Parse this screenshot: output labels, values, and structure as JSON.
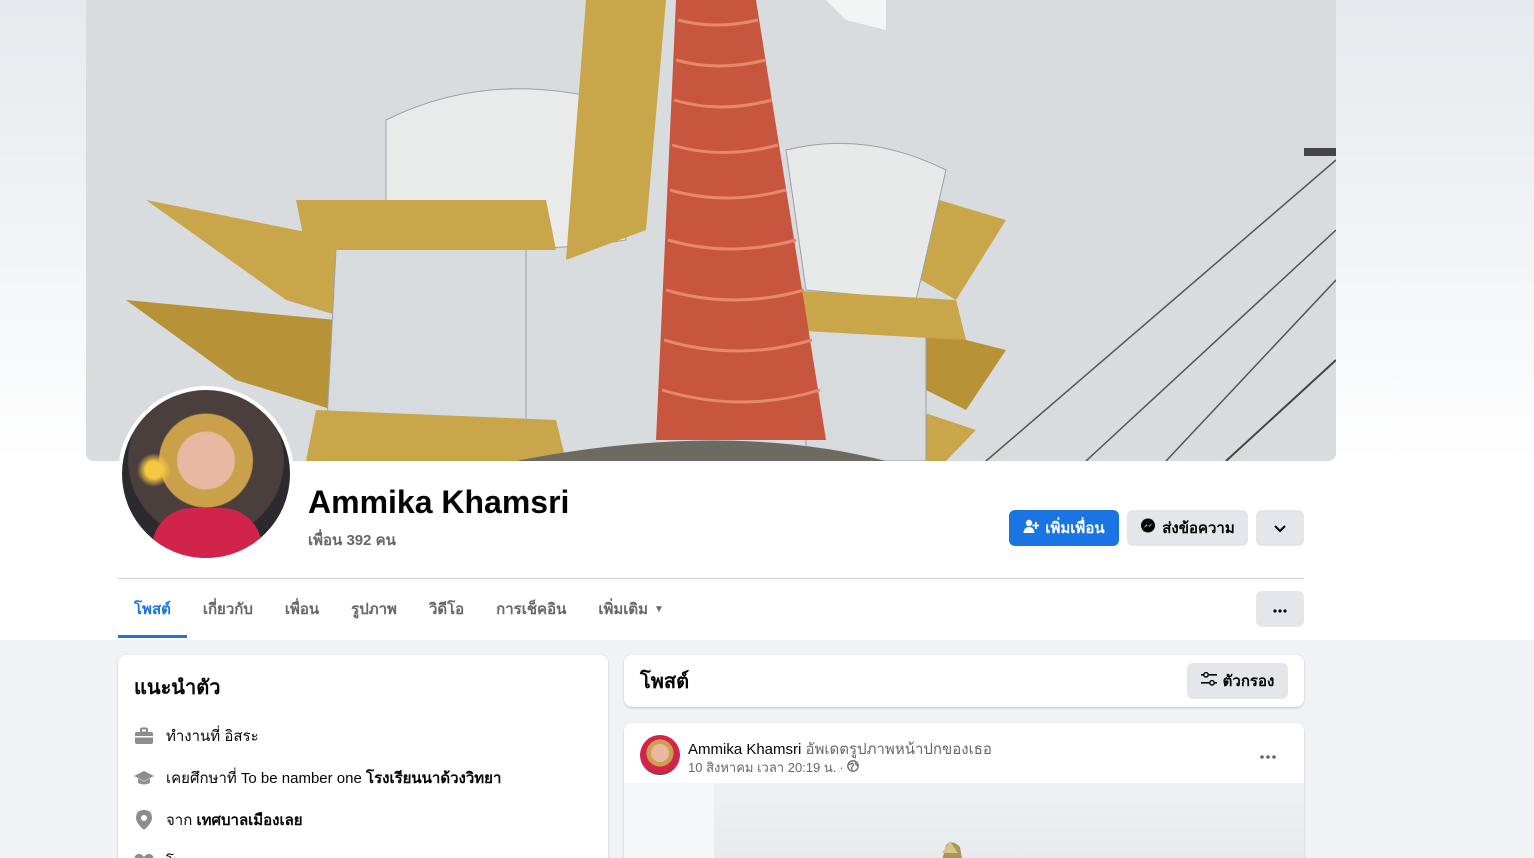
{
  "profile": {
    "name": "Ammika Khamsri",
    "friends_count": "เพื่อน 392 คน"
  },
  "actions": {
    "add_friend": "เพิ่มเพื่อน",
    "message": "ส่งข้อความ"
  },
  "tabs": [
    {
      "label": "โพสต์",
      "active": true
    },
    {
      "label": "เกี่ยวกับ"
    },
    {
      "label": "เพื่อน"
    },
    {
      "label": "รูปภาพ"
    },
    {
      "label": "วิดีโอ"
    },
    {
      "label": "การเช็คอิน"
    },
    {
      "label": "เพิ่มเติม"
    }
  ],
  "intro": {
    "title": "แนะนำตัว",
    "work_prefix": "ทำงานที่",
    "work_value": "อิสระ",
    "study_prefix": "เคยศึกษาที่ To be namber one",
    "study_value": "โรงเรียนนาด้วงวิทยา",
    "from_prefix": "จาก",
    "from_value": "เทศบาลเมืองเลย",
    "relationship": "โสด"
  },
  "posts_section": {
    "title": "โพสต์",
    "filter_label": "ตัวกรอง"
  },
  "post": {
    "author": "Ammika Khamsri",
    "action": "อัพเดตรูปภาพหน้าปกของเธอ",
    "date": "10 สิงหาคม เวลา 20:19 น.",
    "separator": "·"
  },
  "colors": {
    "accent": "#1b74e4",
    "secondary_button": "#e4e6eb",
    "background": "#f0f2f5",
    "muted_text": "#65676b"
  },
  "icons": {
    "add_friend": "person-plus-icon",
    "message": "messenger-icon",
    "dropdown": "chevron-down-icon",
    "more": "ellipsis-icon",
    "filter": "sliders-icon",
    "work": "briefcase-icon",
    "study": "graduation-cap-icon",
    "from": "location-pin-icon",
    "relationship": "heart-icon",
    "privacy": "globe-icon"
  }
}
